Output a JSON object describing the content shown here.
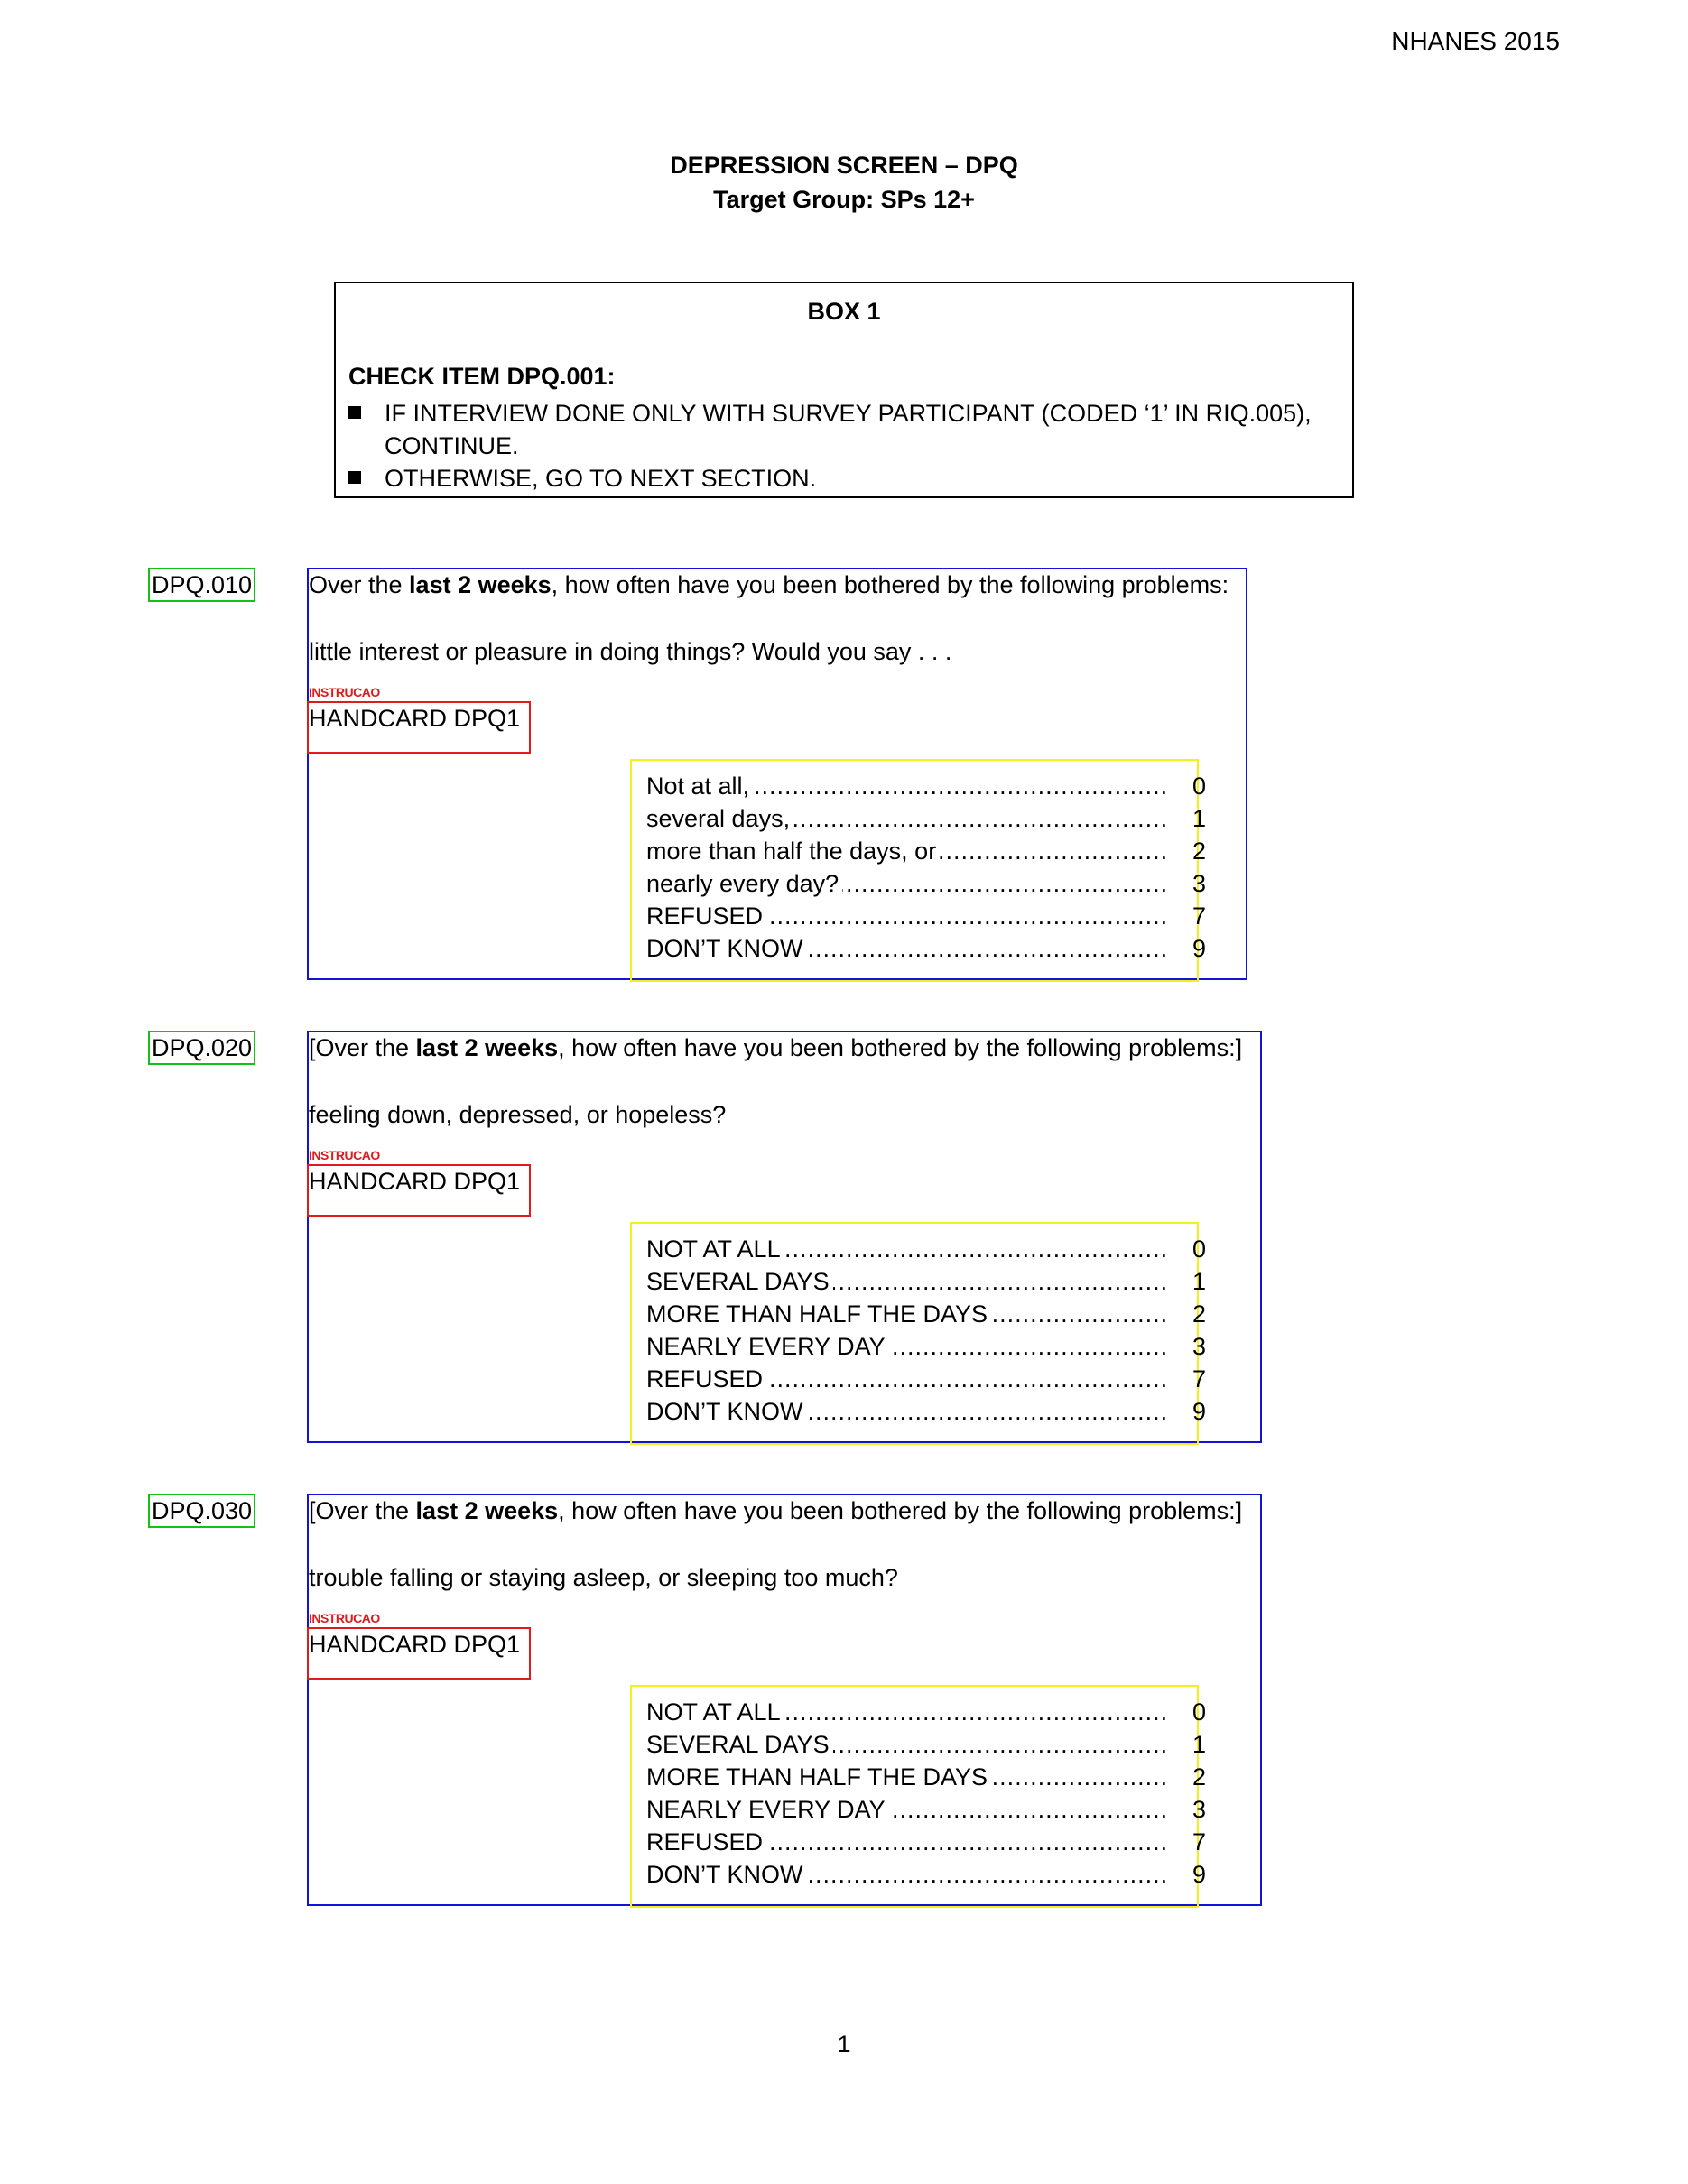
{
  "header": {
    "survey_year": "NHANES 2015"
  },
  "title": {
    "line1": "DEPRESSION SCREEN – DPQ",
    "line2": "Target Group:  SPs 12+"
  },
  "box1": {
    "label": "BOX 1",
    "check_item": "CHECK ITEM DPQ.001:",
    "bullets": [
      "IF INTERVIEW DONE ONLY WITH SURVEY PARTICIPANT (CODED ‘1’ IN RIQ.005), CONTINUE.",
      "OTHERWISE, GO TO NEXT SECTION."
    ]
  },
  "questions": [
    {
      "id": "DPQ.010",
      "stem_pre": "Over the ",
      "stem_bold": "last 2 weeks",
      "stem_post": ", how often have you been bothered by the following problems:",
      "item": "little interest or pleasure in doing things?  Would you say . . .",
      "instruction": "INSTRUCAO",
      "handcard": "HANDCARD DPQ1",
      "options": [
        {
          "label": "Not at all,",
          "code": "0"
        },
        {
          "label": "several days,",
          "code": "1"
        },
        {
          "label": "more than half the days, or",
          "code": "2"
        },
        {
          "label": "nearly every day?",
          "code": "3"
        },
        {
          "label": "REFUSED",
          "code": "7"
        },
        {
          "label": "DON’T KNOW",
          "code": "9"
        }
      ]
    },
    {
      "id": "DPQ.020",
      "stem_pre": "[Over the ",
      "stem_bold": "last 2 weeks",
      "stem_post": ", how often have you been bothered by the following problems:]",
      "item": "feeling down, depressed, or hopeless?",
      "instruction": "INSTRUCAO",
      "handcard": "HANDCARD DPQ1",
      "options": [
        {
          "label": "NOT AT ALL",
          "code": "0"
        },
        {
          "label": "SEVERAL DAYS",
          "code": "1"
        },
        {
          "label": "MORE THAN HALF THE DAYS",
          "code": "2"
        },
        {
          "label": "NEARLY EVERY DAY",
          "code": "3"
        },
        {
          "label": "REFUSED",
          "code": "7"
        },
        {
          "label": "DON’T KNOW",
          "code": "9"
        }
      ]
    },
    {
      "id": "DPQ.030",
      "stem_pre": "[Over the ",
      "stem_bold": "last 2 weeks",
      "stem_post": ", how often have you been bothered by the following problems:]",
      "item": "trouble falling or staying asleep, or sleeping too much?",
      "instruction": "INSTRUCAO",
      "handcard": "HANDCARD DPQ1",
      "options": [
        {
          "label": "NOT AT ALL",
          "code": "0"
        },
        {
          "label": "SEVERAL DAYS",
          "code": "1"
        },
        {
          "label": "MORE THAN HALF THE DAYS",
          "code": "2"
        },
        {
          "label": "NEARLY EVERY DAY",
          "code": "3"
        },
        {
          "label": "REFUSED",
          "code": "7"
        },
        {
          "label": "DON’T KNOW",
          "code": "9"
        }
      ]
    }
  ],
  "footer": {
    "page_number": "1"
  }
}
